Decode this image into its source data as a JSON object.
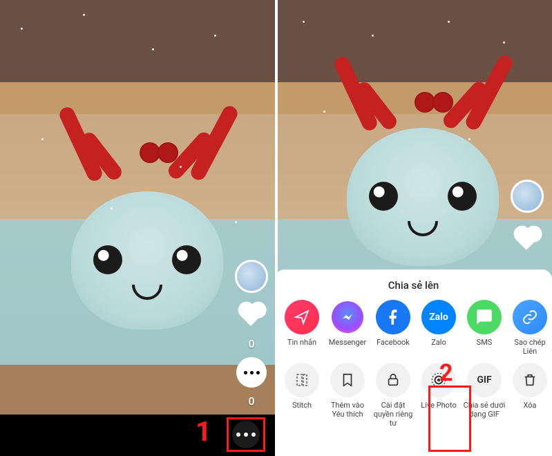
{
  "annotations": {
    "step1": "1",
    "step2": "2"
  },
  "leftSidebar": {
    "like_count": "0",
    "comment_count": "0"
  },
  "shareSheet": {
    "title": "Chia sẻ lên",
    "share_items": [
      {
        "label": "Tin nhắn"
      },
      {
        "label": "Messenger"
      },
      {
        "label": "Facebook"
      },
      {
        "label": "Zalo",
        "badge": "Zalo"
      },
      {
        "label": "SMS"
      },
      {
        "label": "Sao chép Liên"
      }
    ],
    "action_items": [
      {
        "label": "Stitch"
      },
      {
        "label": "Thêm vào Yêu thích"
      },
      {
        "label": "Cài đặt quyền riêng tư"
      },
      {
        "label": "Live Photo"
      },
      {
        "label": "Chia sẻ dưới dạng GIF",
        "badge": "GIF"
      },
      {
        "label": "Xóa"
      }
    ]
  }
}
